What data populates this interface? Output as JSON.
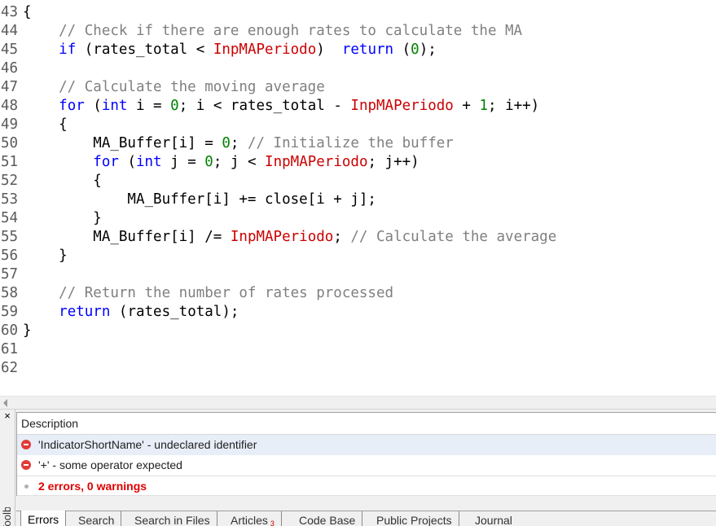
{
  "editor": {
    "lines": [
      {
        "n": "43",
        "fold": "{",
        "code": []
      },
      {
        "n": "44",
        "fold": "",
        "code": [
          {
            "t": "    // Check if there are enough rates to calculate the MA",
            "c": "cm"
          }
        ]
      },
      {
        "n": "45",
        "fold": "",
        "code": [
          {
            "t": "    ",
            "c": ""
          },
          {
            "t": "if",
            "c": "kw"
          },
          {
            "t": " (rates_total < ",
            "c": ""
          },
          {
            "t": "InpMAPeriodo",
            "c": "id"
          },
          {
            "t": ")  ",
            "c": ""
          },
          {
            "t": "return",
            "c": "kw"
          },
          {
            "t": " (",
            "c": ""
          },
          {
            "t": "0",
            "c": "num"
          },
          {
            "t": ");",
            "c": ""
          }
        ]
      },
      {
        "n": "46",
        "fold": "",
        "code": []
      },
      {
        "n": "47",
        "fold": "",
        "code": [
          {
            "t": "    // Calculate the moving average",
            "c": "cm"
          }
        ]
      },
      {
        "n": "48",
        "fold": "",
        "code": [
          {
            "t": "    ",
            "c": ""
          },
          {
            "t": "for",
            "c": "kw"
          },
          {
            "t": " (",
            "c": ""
          },
          {
            "t": "int",
            "c": "kw"
          },
          {
            "t": " i = ",
            "c": ""
          },
          {
            "t": "0",
            "c": "num"
          },
          {
            "t": "; i < rates_total - ",
            "c": ""
          },
          {
            "t": "InpMAPeriodo",
            "c": "id"
          },
          {
            "t": " + ",
            "c": ""
          },
          {
            "t": "1",
            "c": "num"
          },
          {
            "t": "; i++)",
            "c": ""
          }
        ]
      },
      {
        "n": "49",
        "fold": "",
        "code": [
          {
            "t": "    {",
            "c": ""
          }
        ]
      },
      {
        "n": "50",
        "fold": "",
        "code": [
          {
            "t": "        MA_Buffer[i] = ",
            "c": ""
          },
          {
            "t": "0",
            "c": "num"
          },
          {
            "t": "; ",
            "c": ""
          },
          {
            "t": "// Initialize the buffer",
            "c": "cm"
          }
        ]
      },
      {
        "n": "51",
        "fold": "",
        "code": [
          {
            "t": "        ",
            "c": ""
          },
          {
            "t": "for",
            "c": "kw"
          },
          {
            "t": " (",
            "c": ""
          },
          {
            "t": "int",
            "c": "kw"
          },
          {
            "t": " j = ",
            "c": ""
          },
          {
            "t": "0",
            "c": "num"
          },
          {
            "t": "; j < ",
            "c": ""
          },
          {
            "t": "InpMAPeriodo",
            "c": "id"
          },
          {
            "t": "; j++)",
            "c": ""
          }
        ]
      },
      {
        "n": "52",
        "fold": "",
        "code": [
          {
            "t": "        {",
            "c": ""
          }
        ]
      },
      {
        "n": "53",
        "fold": "",
        "code": [
          {
            "t": "            MA_Buffer[i] += close[i + j];",
            "c": ""
          }
        ]
      },
      {
        "n": "54",
        "fold": "",
        "code": [
          {
            "t": "        }",
            "c": ""
          }
        ]
      },
      {
        "n": "55",
        "fold": "",
        "code": [
          {
            "t": "        MA_Buffer[i] /= ",
            "c": ""
          },
          {
            "t": "InpMAPeriodo",
            "c": "id"
          },
          {
            "t": "; ",
            "c": ""
          },
          {
            "t": "// Calculate the average",
            "c": "cm"
          }
        ]
      },
      {
        "n": "56",
        "fold": "",
        "code": [
          {
            "t": "    }",
            "c": ""
          }
        ]
      },
      {
        "n": "57",
        "fold": "",
        "code": []
      },
      {
        "n": "58",
        "fold": "",
        "code": [
          {
            "t": "    // Return the number of rates processed",
            "c": "cm"
          }
        ]
      },
      {
        "n": "59",
        "fold": "",
        "code": [
          {
            "t": "    ",
            "c": ""
          },
          {
            "t": "return",
            "c": "kw"
          },
          {
            "t": " (rates_total);",
            "c": ""
          }
        ]
      },
      {
        "n": "60",
        "fold": "}",
        "code": []
      },
      {
        "n": "61",
        "fold": "",
        "code": []
      },
      {
        "n": "62",
        "fold": "",
        "code": []
      }
    ]
  },
  "toolbox": {
    "title": "Toolbox",
    "close_label": "×",
    "messages": {
      "header": "Description",
      "rows": [
        {
          "text": "'IndicatorShortName' - undeclared identifier",
          "icon": "error-icon"
        },
        {
          "text": "'+' - some operator expected",
          "icon": "error-icon"
        }
      ],
      "summary": "2 errors, 0 warnings"
    },
    "tabs": [
      {
        "label": "Errors",
        "badge": ""
      },
      {
        "label": "Search",
        "badge": ""
      },
      {
        "label": "Search in Files",
        "badge": ""
      },
      {
        "label": "Articles",
        "badge": "3"
      },
      {
        "label": "Code Base",
        "badge": ""
      },
      {
        "label": "Public Projects",
        "badge": ""
      },
      {
        "label": "Journal",
        "badge": ""
      }
    ]
  },
  "colors": {
    "keyword": "#0000ff",
    "comment": "#808080",
    "number": "#008000",
    "input_param": "#cc0000",
    "error": "#e23a3a",
    "summary": "#e00000"
  }
}
